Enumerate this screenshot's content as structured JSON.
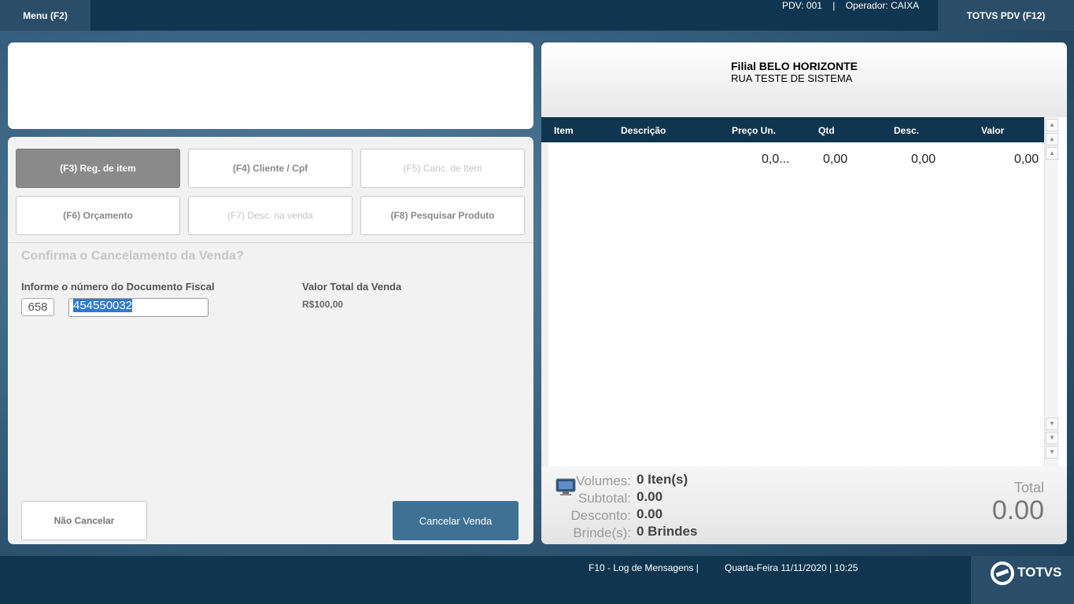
{
  "topbar": {
    "menu_label": "Menu (F2)",
    "pdv_info": "PDV: 001    |    Operador: CAIXA",
    "totvs_label": "TOTVS PDV (F12)"
  },
  "functions": [
    {
      "label": "(F3) Reg. de item"
    },
    {
      "label": "(F4) Cliente / Cpf"
    },
    {
      "label": "(F5) Canc. de Item"
    },
    {
      "label": "(F6) Orçamento"
    },
    {
      "label": "(F7) Desc. na venda"
    },
    {
      "label": "(F8) Pesquisar Produto"
    }
  ],
  "cancel_form": {
    "title": "Confirma o Cancelamento da Venda?",
    "doc_label": "Informe o número do Documento Fiscal",
    "serie_value": "658",
    "doc_value": "454550032",
    "total_label": "Valor Total da Venda",
    "total_value": "R$100,00",
    "btn_nao": "Não Cancelar",
    "btn_cancelar": "Cancelar Venda"
  },
  "receipt": {
    "filial": "Filial BELO HORIZONTE",
    "address": "RUA TESTE DE SISTEMA",
    "columns": [
      "Item",
      "Descrição",
      "Preço Un.",
      "Qtd",
      "Desc.",
      "Valor"
    ],
    "row": {
      "item": "",
      "descricao": "",
      "preco": "0,0...",
      "qtd": "0,00",
      "desc": "0,00",
      "valor": "0,00"
    }
  },
  "totals": {
    "volumes_label": "Volumes:",
    "volumes_value": "0 Iten(s)",
    "subtotal_label": "Subtotal:",
    "subtotal_value": "0.00",
    "desconto_label": "Desconto:",
    "desconto_value": "0.00",
    "brindes_label": "Brinde(s):",
    "brindes_value": "0 Brindes",
    "total_label": "Total",
    "total_value": "0.00"
  },
  "bottombar": {
    "log": "F10 - Log de Mensagens |",
    "datetime": "Quarta-Feira 11/11/2020 | 10:25",
    "logo": "TOTVS"
  }
}
